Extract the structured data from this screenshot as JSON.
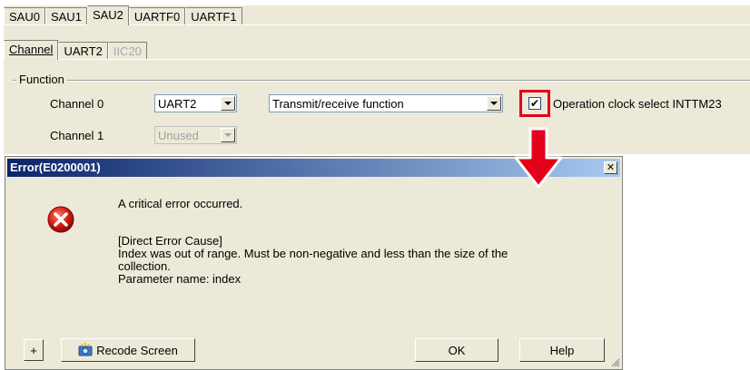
{
  "top_tabs": [
    "SAU0",
    "SAU1",
    "SAU2",
    "UARTF0",
    "UARTF1"
  ],
  "top_tab_active": "SAU2",
  "sub_tabs": [
    "Channel",
    "UART2",
    "IIC20"
  ],
  "group": {
    "label": "Function"
  },
  "channel0": {
    "label": "Channel 0",
    "mode_value": "UART2",
    "function_value": "Transmit/receive function",
    "checkbox_checked": true,
    "checkbox_mark": "✔",
    "checkbox_label": "Operation clock select INTTM23"
  },
  "channel1": {
    "label": "Channel 1",
    "mode_value": "Unused"
  },
  "annotation_color": "#e3001b",
  "dialog": {
    "title": "Error(E0200001)",
    "close_glyph": "✕",
    "icon": "error-icon",
    "line1": "A critical error occurred.",
    "cause_header": "[Direct Error Cause]",
    "cause_line1": "Index was out of range. Must be non-negative and less than the size of the",
    "cause_line2": "collection.",
    "cause_line3": "Parameter name: index",
    "plus_label": "+",
    "recode_label": "Recode Screen",
    "ok_label": "OK",
    "help_label": "Help"
  }
}
